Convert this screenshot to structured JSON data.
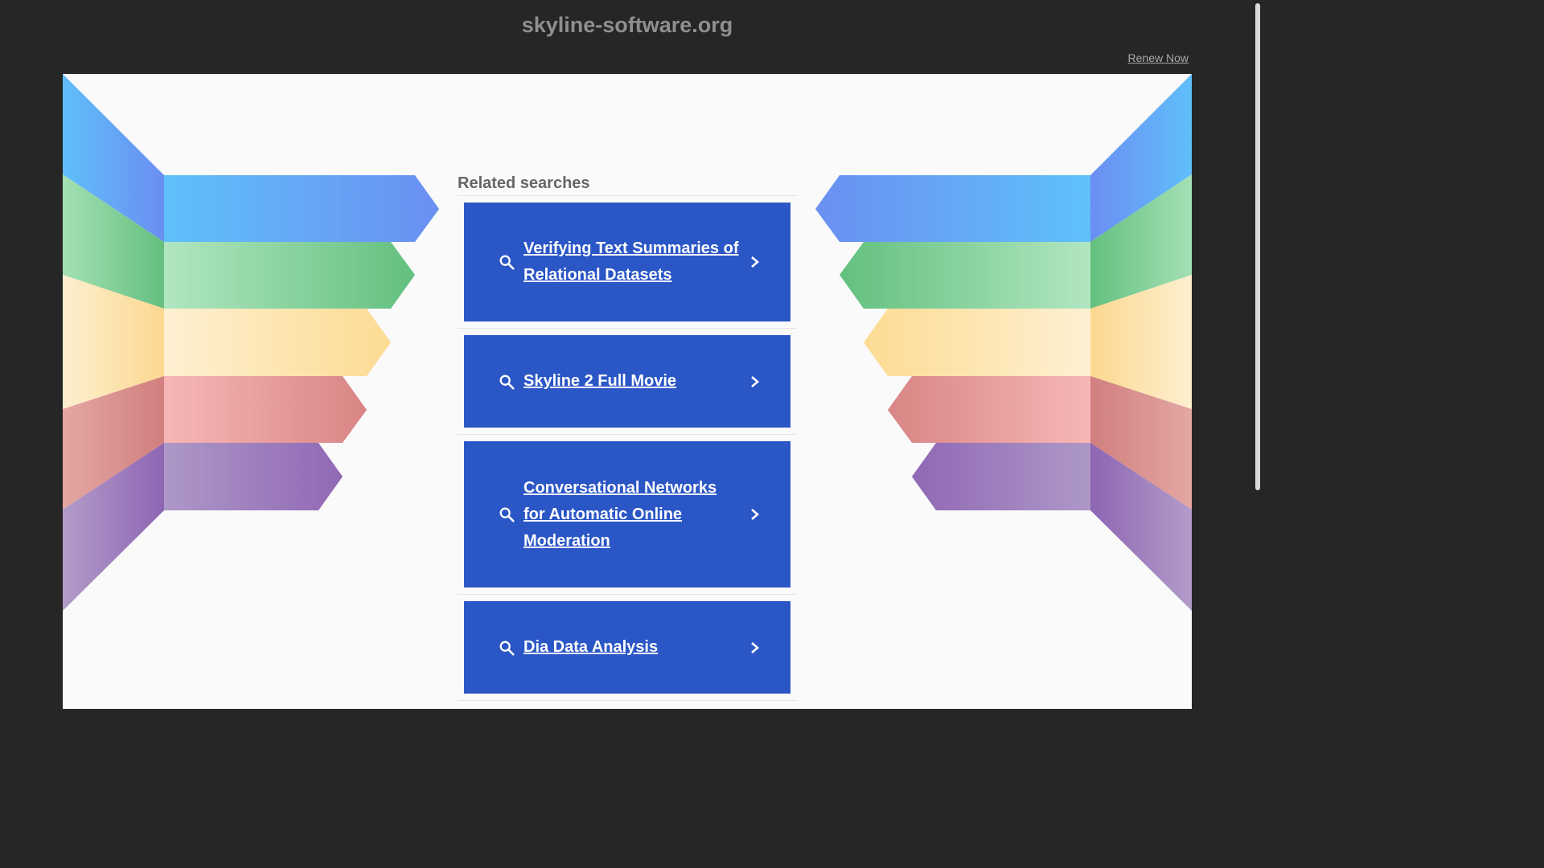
{
  "header": {
    "domain": "skyline-software.org",
    "renew_label": "Renew Now"
  },
  "related": {
    "heading": "Related searches",
    "items": [
      {
        "label": "Verifying Text Summaries of Relational Datasets"
      },
      {
        "label": "Skyline 2 Full Movie"
      },
      {
        "label": "Conversational Networks for Automatic Online Moderation"
      },
      {
        "label": "Dia Data Analysis"
      }
    ]
  },
  "colors": {
    "background": "#262626",
    "panel": "#fafafa",
    "button": "#2b56c6",
    "blue": "#5aa0f5",
    "green": "#7ccf93",
    "yellow": "#fde2a3",
    "red": "#e9a4a4",
    "purple": "#a48cc4"
  },
  "icons": [
    "search-icon",
    "chevron-right-icon"
  ]
}
